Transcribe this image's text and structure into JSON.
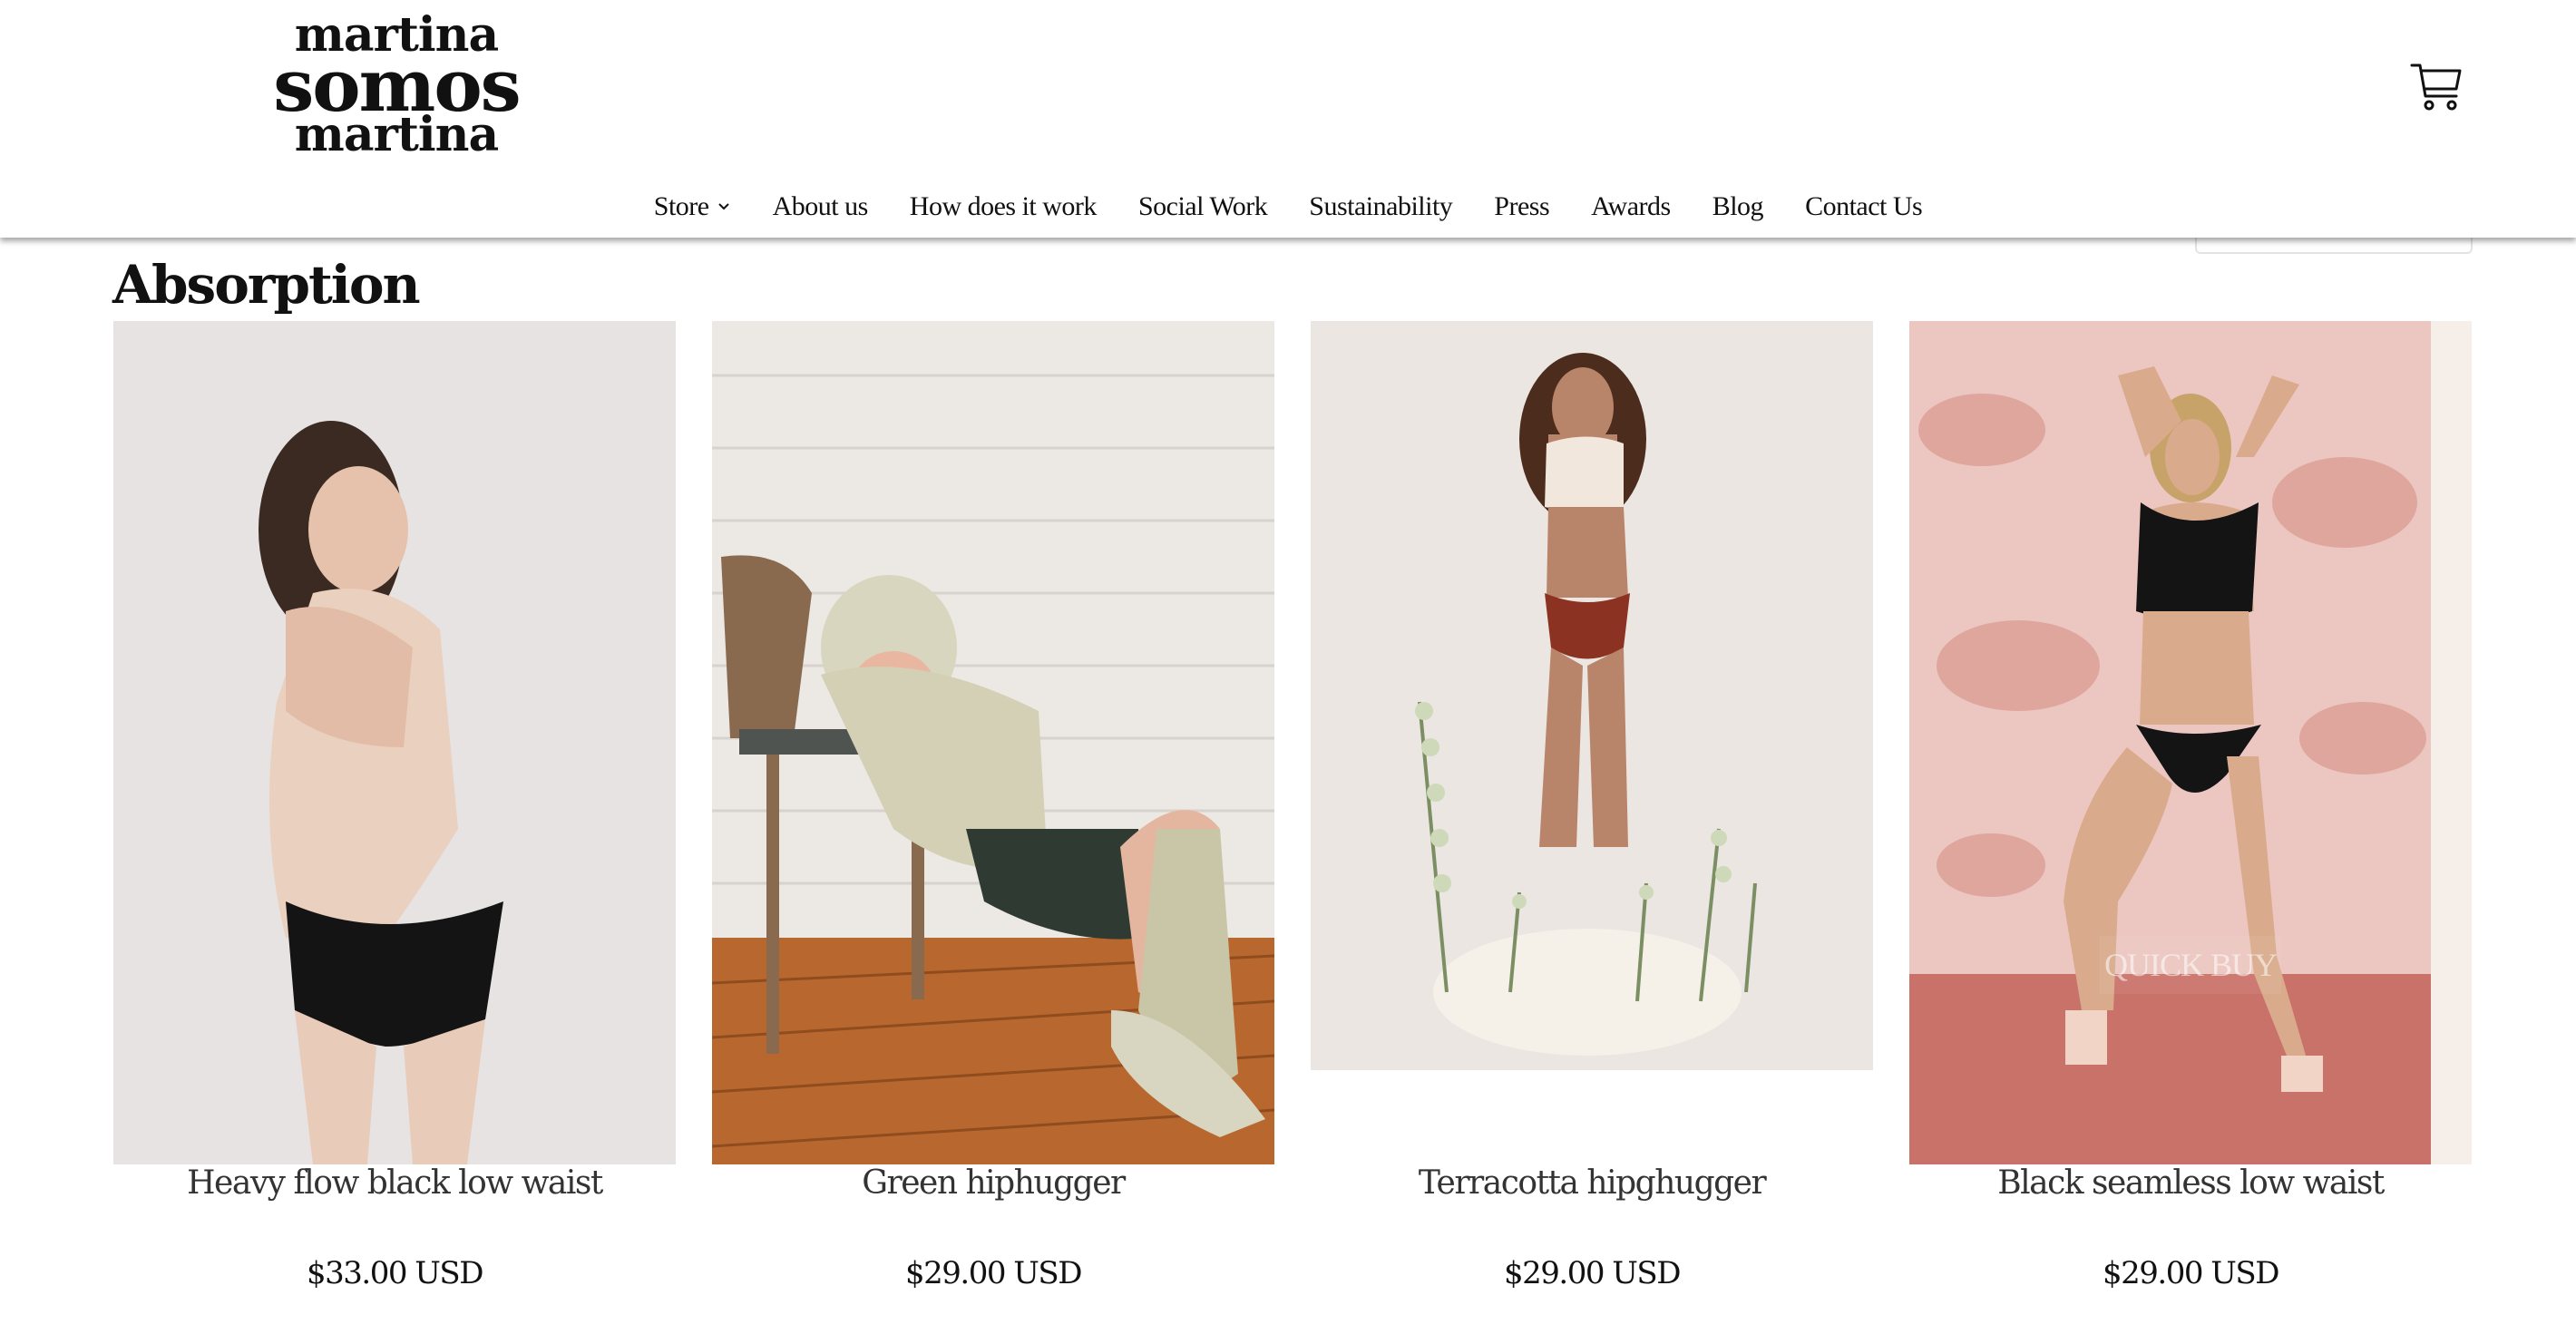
{
  "brand": {
    "logo_line1": "martina",
    "logo_line2": "somos",
    "logo_line3": "martina"
  },
  "nav": {
    "items": [
      {
        "label": "Store"
      },
      {
        "label": "About us"
      },
      {
        "label": "How does it work"
      },
      {
        "label": "Social Work"
      },
      {
        "label": "Sustainability"
      },
      {
        "label": "Press"
      },
      {
        "label": "Awards"
      },
      {
        "label": "Blog"
      },
      {
        "label": "Contact Us"
      }
    ]
  },
  "section": {
    "title": "Absorption"
  },
  "products": [
    {
      "name": "Heavy flow black low waist",
      "price": "$33.00 USD"
    },
    {
      "name": "Green hiphugger",
      "price": "$29.00 USD"
    },
    {
      "name": "Terracotta hipghugger",
      "price": "$29.00 USD"
    },
    {
      "name": "Black seamless low waist",
      "price": "$29.00 USD",
      "quick_buy": "QUICK BUY"
    }
  ],
  "icons": {
    "cart": "shopping-cart-icon",
    "store_dropdown": "chevron-down-icon"
  }
}
